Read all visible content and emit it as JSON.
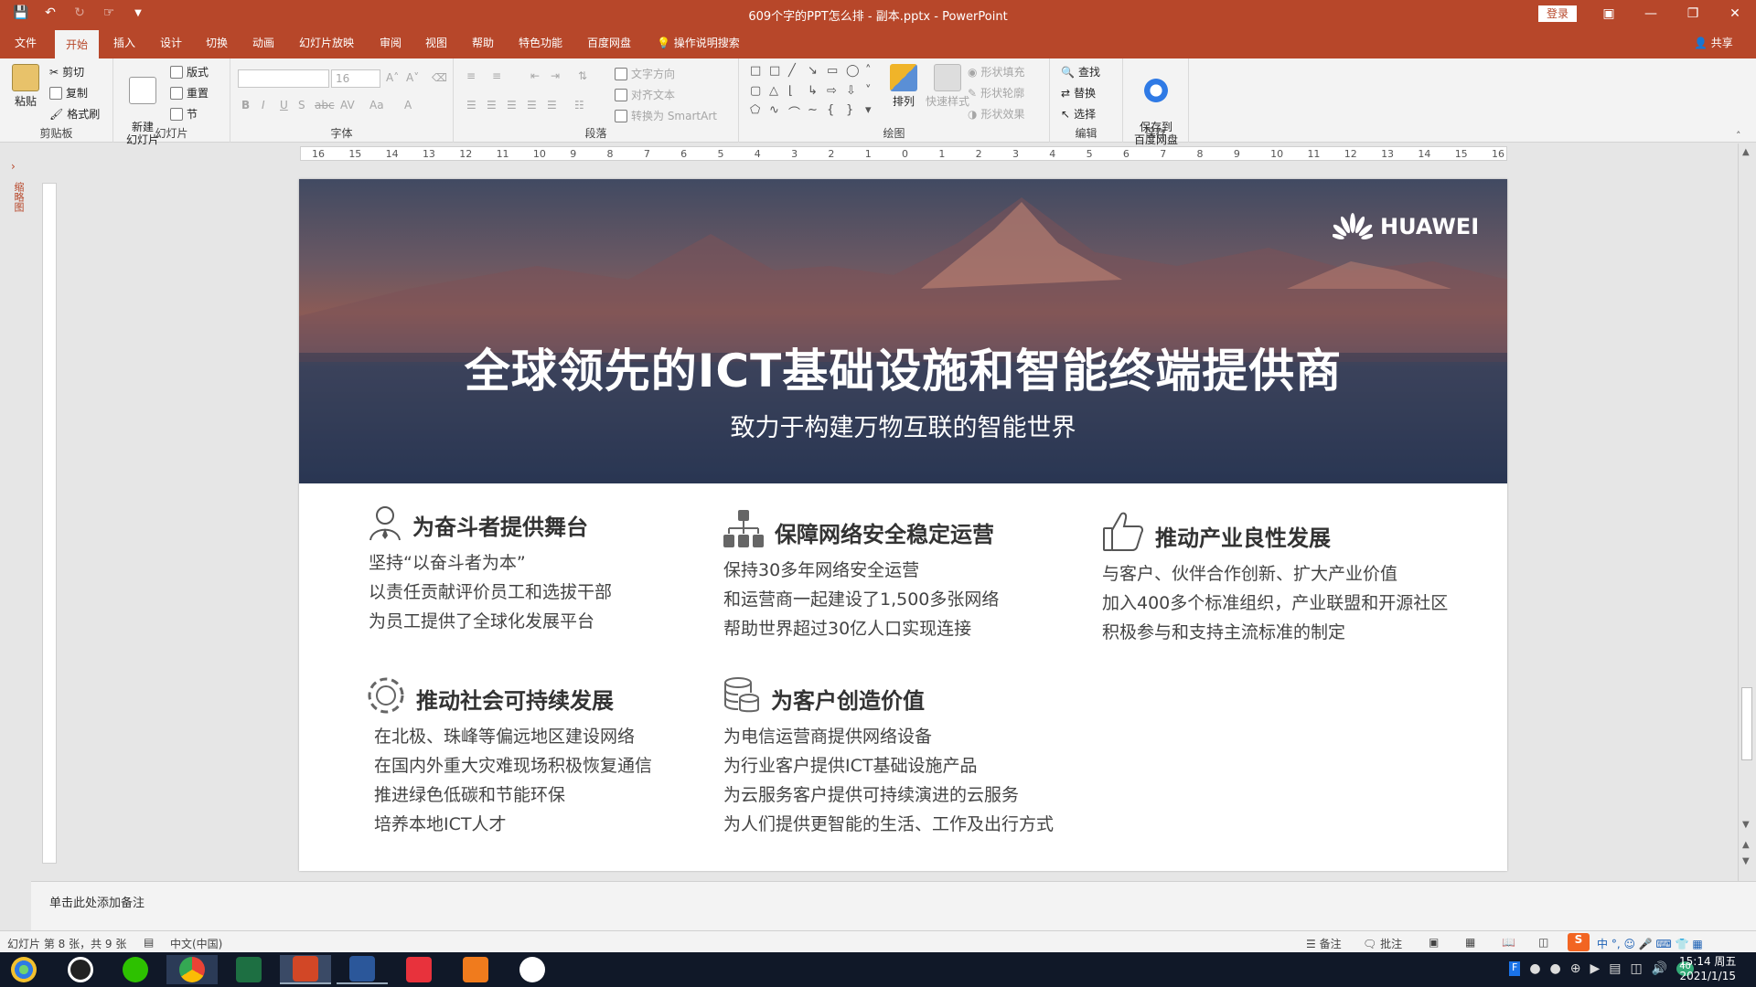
{
  "window": {
    "title": "609个字的PPT怎么排 - 副本.pptx  -  PowerPoint",
    "login_label": "登录"
  },
  "tabs": [
    "文件",
    "开始",
    "插入",
    "设计",
    "切换",
    "动画",
    "幻灯片放映",
    "审阅",
    "视图",
    "帮助",
    "特色功能",
    "百度网盘"
  ],
  "active_tab": "开始",
  "tell_me": "操作说明搜索",
  "share": "共享",
  "ribbon": {
    "clipboard": {
      "label": "剪贴板",
      "paste": "粘贴",
      "cut": "剪切",
      "copy": "复制",
      "format_painter": "格式刷"
    },
    "slides": {
      "label": "幻灯片",
      "new_slide": "新建\n幻灯片",
      "layout": "版式",
      "reset": "重置",
      "section": "节"
    },
    "font": {
      "label": "字体",
      "size": "16",
      "font_name": ""
    },
    "paragraph": {
      "label": "段落",
      "text_direction": "文字方向",
      "align_text": "对齐文本",
      "smartart": "转换为 SmartArt"
    },
    "drawing": {
      "label": "绘图",
      "arrange": "排列",
      "quick_styles": "快速样式",
      "shape_fill": "形状填充",
      "shape_outline": "形状轮廓",
      "shape_effects": "形状效果"
    },
    "editing": {
      "label": "编辑",
      "find": "查找",
      "replace": "替换",
      "select": "选择"
    },
    "save": {
      "label": "保存",
      "save_to_baidu": "保存到\n百度网盘"
    }
  },
  "ruler_h": [
    "16",
    "15",
    "14",
    "13",
    "12",
    "11",
    "10",
    "9",
    "8",
    "7",
    "6",
    "5",
    "4",
    "3",
    "2",
    "1",
    "0",
    "1",
    "2",
    "3",
    "4",
    "5",
    "6",
    "7",
    "8",
    "9",
    "10",
    "11",
    "12",
    "13",
    "14",
    "15",
    "16"
  ],
  "left_panel_label": "缩略图",
  "slide": {
    "brand": "HUAWEI",
    "title": "全球领先的ICT基础设施和智能终端提供商",
    "subtitle": "致力于构建万物互联的智能世界",
    "sections": [
      {
        "heading": "为奋斗者提供舞台",
        "icon": "person-icon",
        "lines": [
          "坚持“以奋斗者为本”",
          "以责任贡献评价员工和选拔干部",
          "为员工提供了全球化发展平台"
        ]
      },
      {
        "heading": "保障网络安全稳定运营",
        "icon": "network-icon",
        "lines": [
          "保持30多年网络安全运营",
          "和运营商一起建设了1,500多张网络",
          "帮助世界超过30亿人口实现连接"
        ]
      },
      {
        "heading": "推动产业良性发展",
        "icon": "thumbs-up-icon",
        "lines": [
          "与客户、伙伴合作创新、扩大产业价值",
          "加入400多个标准组织，产业联盟和开源社区",
          "积极参与和支持主流标准的制定"
        ]
      },
      {
        "heading": "推动社会可持续发展",
        "icon": "cycle-icon",
        "lines": [
          "在北极、珠峰等偏远地区建设网络",
          "在国内外重大灾难现场积极恢复通信",
          "推进绿色低碳和节能环保",
          "培养本地ICT人才"
        ]
      },
      {
        "heading": "为客户创造价值",
        "icon": "database-icon",
        "lines": [
          "为电信运营商提供网络设备",
          "为行业客户提供ICT基础设施产品",
          "为云服务客户提供可持续演进的云服务",
          "为人们提供更智能的生活、工作及出行方式"
        ]
      }
    ]
  },
  "notes_placeholder": "单击此处添加备注",
  "status": {
    "slide_info": "幻灯片 第 8 张，共 9 张",
    "language": "中文(中国)",
    "notes": "备注",
    "comments": "批注"
  },
  "clock": {
    "time": "15:14 周五",
    "date": "2021/1/15"
  },
  "colors": {
    "accent": "#b7472a",
    "taskbar": "#101828"
  }
}
